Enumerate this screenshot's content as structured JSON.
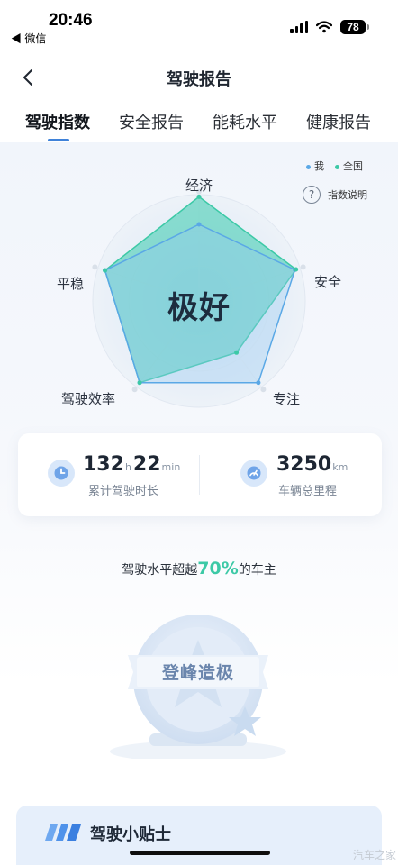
{
  "status_bar": {
    "time": "20:46",
    "back_app": "◀ 微信",
    "battery": "78"
  },
  "nav": {
    "title": "驾驶报告"
  },
  "tabs": [
    {
      "label": "驾驶指数",
      "active": true
    },
    {
      "label": "安全报告",
      "active": false
    },
    {
      "label": "能耗水平",
      "active": false
    },
    {
      "label": "健康报告",
      "active": false
    }
  ],
  "legend": {
    "me": "我",
    "national": "全国",
    "me_color": "#5aa8e6",
    "national_color": "#3cc9a6"
  },
  "help": {
    "icon_char": "?",
    "label": "指数说明"
  },
  "chart_data": {
    "type": "radar",
    "axes": [
      "经济",
      "安全",
      "专注",
      "驾驶效率",
      "平稳"
    ],
    "series": [
      {
        "name": "我",
        "values": [
          0.72,
          0.95,
          0.95,
          0.95,
          0.93
        ]
      },
      {
        "name": "全国",
        "values": [
          0.98,
          0.96,
          0.6,
          0.95,
          0.93
        ]
      }
    ],
    "range": [
      0,
      1
    ],
    "rating": "极好"
  },
  "stats": {
    "duration": {
      "hours": "132",
      "hours_unit": "h",
      "minutes": "22",
      "minutes_unit": "min",
      "caption": "累计驾驶时长"
    },
    "mileage": {
      "value": "3250",
      "unit": "km",
      "caption": "车辆总里程"
    }
  },
  "beat": {
    "prefix": "驾驶水平超越",
    "percent": "70%",
    "suffix": "的车主"
  },
  "medal": {
    "title": "登峰造极"
  },
  "tips": {
    "title": "驾驶小贴士"
  },
  "watermark": "汽车之家"
}
